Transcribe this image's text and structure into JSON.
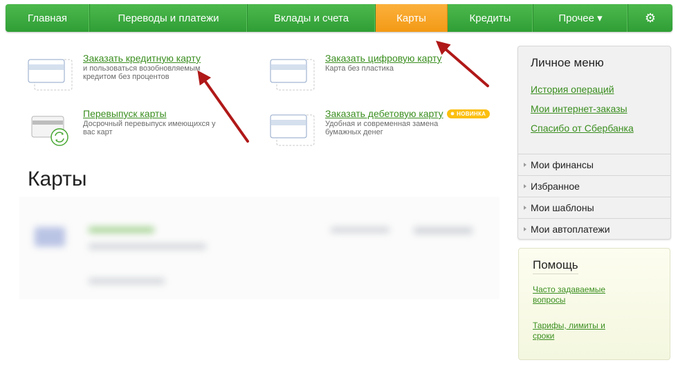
{
  "nav": {
    "items": [
      "Главная",
      "Переводы и платежи",
      "Вклады и счета",
      "Карты",
      "Кредиты",
      "Прочее ▾"
    ],
    "active_index": 3,
    "settings_icon": "gear-icon"
  },
  "tiles": [
    {
      "title": "Заказать кредитную карту",
      "subtitle": "и пользоваться возобновляемым кредитом без процентов",
      "icon": "credit-card-icon"
    },
    {
      "title": "Заказать цифровую карту",
      "subtitle": "Карта без пластика",
      "icon": "digital-card-icon"
    },
    {
      "title": "Перевыпуск карты",
      "subtitle": "Досрочный перевыпуск имеющихся у вас карт",
      "icon": "reissue-card-icon"
    },
    {
      "title": "Заказать дебетовую карту",
      "subtitle": "Удобная и современная замена бумажных денег",
      "icon": "debit-card-icon",
      "badge": "НОВИНКА"
    }
  ],
  "page_title": "Карты",
  "personal_menu": {
    "title": "Личное меню",
    "links": [
      "История операций",
      "Мои интернет-заказы",
      "Спасибо от Сбербанка"
    ],
    "sections": [
      "Мои финансы",
      "Избранное",
      "Мои шаблоны",
      "Мои автоплатежи"
    ]
  },
  "help": {
    "title": "Помощь",
    "links": [
      "Часто задаваемые вопросы",
      "Тарифы, лимиты и сроки"
    ]
  },
  "colors": {
    "nav_green": "#3aa93e",
    "nav_active": "#f7a21f",
    "link_green": "#3a8e1f",
    "arrow_red": "#b01818"
  }
}
